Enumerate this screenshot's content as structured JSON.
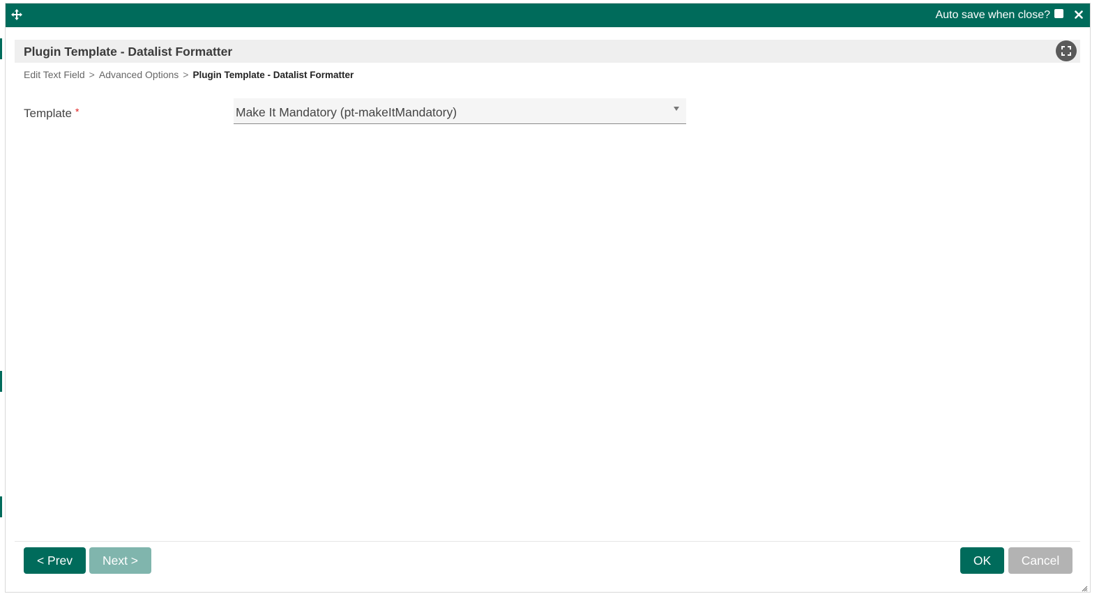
{
  "titlebar": {
    "autosave_label": "Auto save when close?",
    "autosave_checked": false,
    "move_icon": "move-icon",
    "close_icon": "close-icon"
  },
  "header": {
    "title": "Plugin Template - Datalist Formatter",
    "fullscreen_icon": "fullscreen-icon"
  },
  "breadcrumb": {
    "items": [
      "Edit Text Field",
      "Advanced Options",
      "Plugin Template - Datalist Formatter"
    ],
    "separator": ">"
  },
  "form": {
    "template_label": "Template",
    "required_mark": "*",
    "template_value": "Make It Mandatory (pt-makeItMandatory)"
  },
  "footer": {
    "prev_label": "< Prev",
    "next_label": "Next >",
    "ok_label": "OK",
    "cancel_label": "Cancel"
  },
  "colors": {
    "brand": "#006b5b",
    "disabled_brand": "#80b5ad",
    "cancel": "#b3b3b3",
    "required": "#e02020"
  }
}
